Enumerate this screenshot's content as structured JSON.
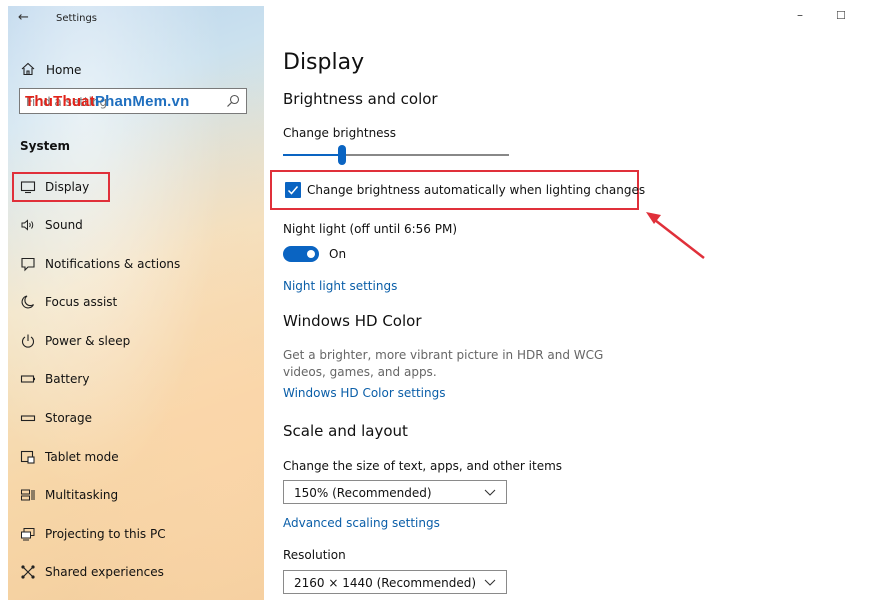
{
  "window": {
    "title": "Settings",
    "controls": {
      "minimize": "–",
      "maximize": "☐"
    }
  },
  "sidebar": {
    "home_label": "Home",
    "search": {
      "placeholder": "Find a setting",
      "watermark_a": "ThuThuat",
      "watermark_b": "PhanMem",
      "watermark_c": ".vn"
    },
    "section_title": "System",
    "items": [
      {
        "label": "Display",
        "icon": "monitor-icon"
      },
      {
        "label": "Sound",
        "icon": "speaker-icon"
      },
      {
        "label": "Notifications & actions",
        "icon": "notification-icon"
      },
      {
        "label": "Focus assist",
        "icon": "moon-icon"
      },
      {
        "label": "Power & sleep",
        "icon": "power-icon"
      },
      {
        "label": "Battery",
        "icon": "battery-icon"
      },
      {
        "label": "Storage",
        "icon": "storage-icon"
      },
      {
        "label": "Tablet mode",
        "icon": "tablet-icon"
      },
      {
        "label": "Multitasking",
        "icon": "multitasking-icon"
      },
      {
        "label": "Projecting to this PC",
        "icon": "projecting-icon"
      },
      {
        "label": "Shared experiences",
        "icon": "shared-icon"
      }
    ]
  },
  "main": {
    "title": "Display",
    "brightness": {
      "heading": "Brightness and color",
      "slider_label": "Change brightness",
      "slider_value": 0.26,
      "auto_label": "Change brightness automatically when lighting changes",
      "auto_checked": true,
      "night_light_label": "Night light (off until 6:56 PM)",
      "night_light_state": "On",
      "night_light_link": "Night light settings"
    },
    "hdr": {
      "heading": "Windows HD Color",
      "description": "Get a brighter, more vibrant picture in HDR and WCG videos, games, and apps.",
      "link": "Windows HD Color settings"
    },
    "scale": {
      "heading": "Scale and layout",
      "size_label": "Change the size of text, apps, and other items",
      "size_value": "150% (Recommended)",
      "advanced_link": "Advanced scaling settings",
      "resolution_label": "Resolution",
      "resolution_value": "2160 × 1440 (Recommended)"
    }
  },
  "colors": {
    "accent": "#0a64c2",
    "highlight": "#e0303a",
    "link": "#0a5ea8"
  }
}
